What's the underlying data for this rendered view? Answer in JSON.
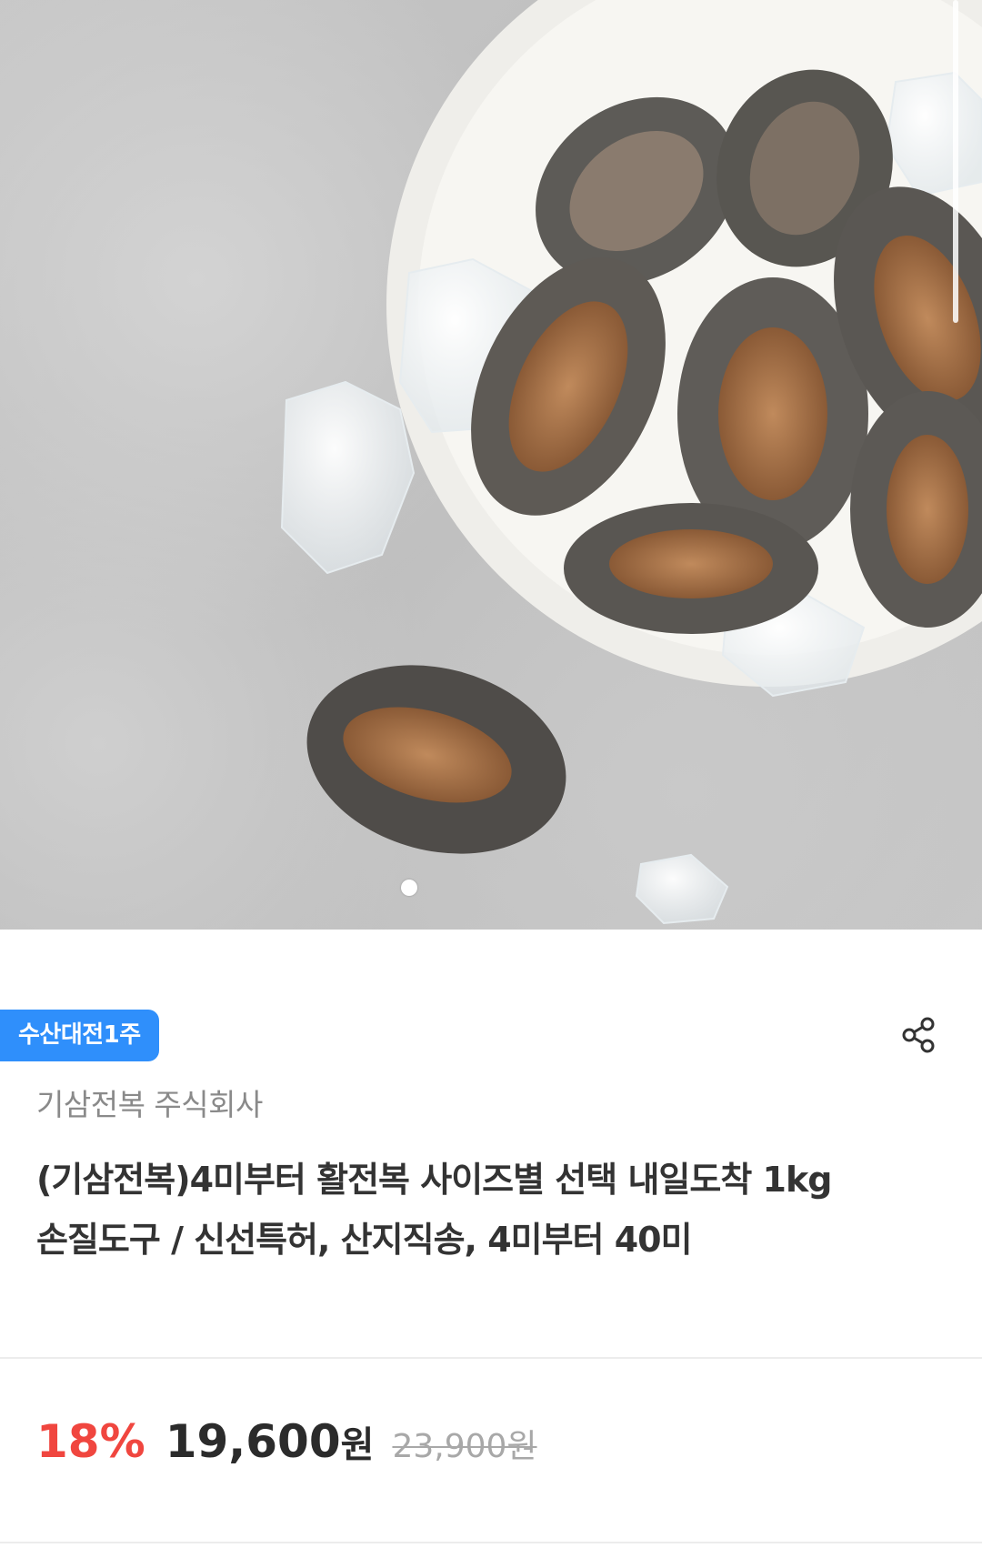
{
  "badge": {
    "label": "수산대전1주"
  },
  "product": {
    "seller": "기삼전복 주식회사",
    "title": "(기삼전복)4미부터 활전복 사이즈별 선택 내일도착 1kg 손질도구 / 신선특허, 산지직송, 4미부터 40미"
  },
  "price": {
    "discount": "18%",
    "sale": "19,600",
    "sale_unit": "원",
    "original": "23,900원"
  },
  "carousel": {
    "total": 1,
    "current": 1
  },
  "icons": {
    "share": "share-icon"
  },
  "colors": {
    "badge": "#2f8ffb",
    "discount": "#f0463f",
    "price": "#2b2b2b",
    "original_price": "#a8a8a8",
    "seller": "#8a8a8a"
  }
}
